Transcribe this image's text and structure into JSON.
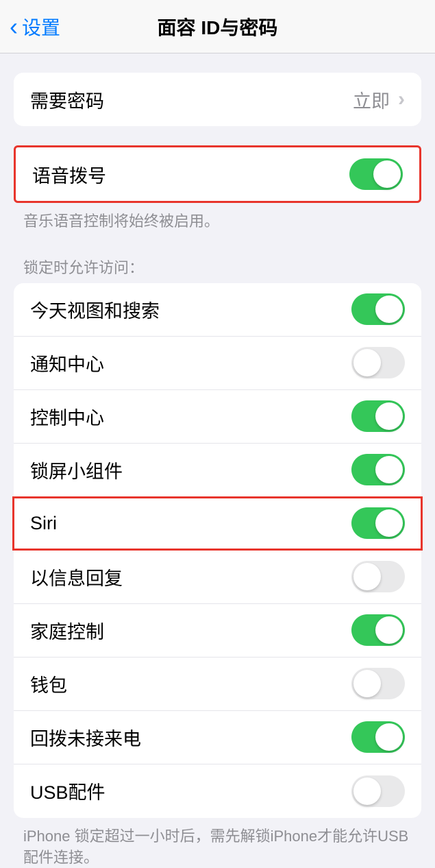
{
  "header": {
    "back_label": "设置",
    "title": "面容 ID与密码"
  },
  "passcode_row": {
    "label": "需要密码",
    "value": "立即"
  },
  "voice_dial": {
    "label": "语音拨号",
    "footer": "音乐语音控制将始终被启用。",
    "on": true
  },
  "allow_access_header": "锁定时允许访问：",
  "access_items": [
    {
      "label": "今天视图和搜索",
      "on": true
    },
    {
      "label": "通知中心",
      "on": false
    },
    {
      "label": "控制中心",
      "on": true
    },
    {
      "label": "锁屏小组件",
      "on": true
    },
    {
      "label": "Siri",
      "on": true,
      "highlighted": true
    },
    {
      "label": "以信息回复",
      "on": false
    },
    {
      "label": "家庭控制",
      "on": true
    },
    {
      "label": "钱包",
      "on": false
    },
    {
      "label": "回拨未接来电",
      "on": true
    },
    {
      "label": "USB配件",
      "on": false
    }
  ],
  "usb_footer": "iPhone 锁定超过一小时后，需先解锁iPhone才能允许USB 配件连接。"
}
